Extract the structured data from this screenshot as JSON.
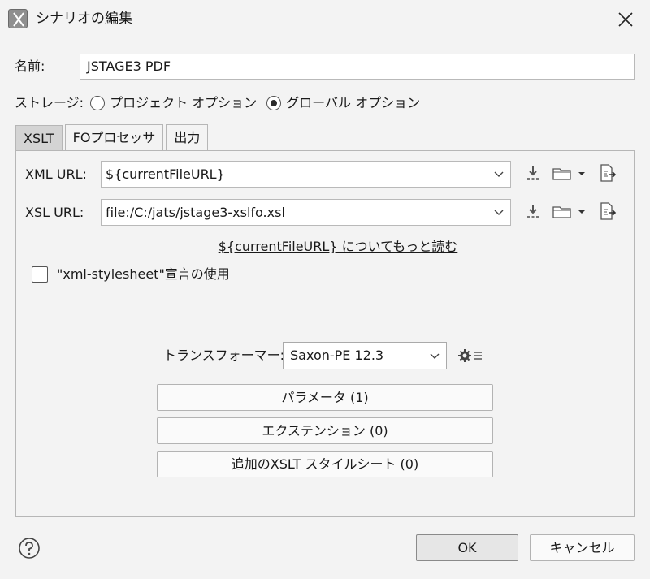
{
  "window": {
    "title": "シナリオの編集"
  },
  "name": {
    "label": "名前:",
    "value": "JSTAGE3 PDF"
  },
  "storage": {
    "label": "ストレージ:",
    "options": [
      {
        "label": "プロジェクト オプション",
        "selected": false
      },
      {
        "label": "グローバル オプション",
        "selected": true
      }
    ]
  },
  "tabs": [
    {
      "label": "XSLT",
      "active": true
    },
    {
      "label": "FOプロセッサ",
      "active": false
    },
    {
      "label": "出力",
      "active": false
    }
  ],
  "xslt": {
    "xml_url": {
      "label": "XML URL:",
      "value": "${currentFileURL}"
    },
    "xsl_url": {
      "label": "XSL URL:",
      "value": "file:/C:/jats/jstage3-xslfo.xsl"
    },
    "link": "${currentFileURL} についてもっと読む",
    "stylesheet_checkbox": {
      "label": "\"xml-stylesheet\"宣言の使用",
      "checked": false
    },
    "transformer": {
      "label": "トランスフォーマー:",
      "value": "Saxon-PE 12.3"
    },
    "buttons": {
      "parameters": "パラメータ (1)",
      "extensions": "エクステンション (0)",
      "additional_xslt": "追加のXSLT スタイルシート (0)"
    }
  },
  "footer": {
    "ok": "OK",
    "cancel": "キャンセル"
  },
  "icons": {
    "app": "app-x-icon",
    "close": "close-icon",
    "insert": "insert-editor-variable-icon",
    "browse": "folder-icon",
    "open_in_editor": "open-in-editor-icon",
    "settings": "gear-list-icon",
    "help": "help-icon"
  }
}
